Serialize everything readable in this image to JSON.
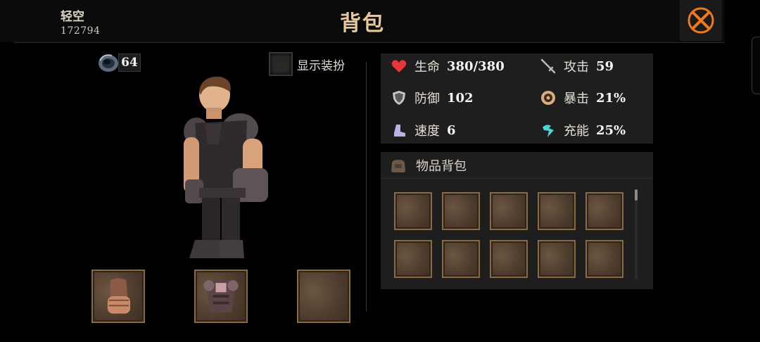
{
  "header": {
    "user_name": "轻空",
    "user_id": "172794",
    "title": "背包"
  },
  "currency": {
    "icon": "ring-currency-icon",
    "value": "64"
  },
  "toggle": {
    "label": "显示装扮",
    "checked": false
  },
  "equipment": {
    "slots": [
      {
        "item": "gauntlet",
        "icon": "gauntlet-icon"
      },
      {
        "item": "chest-armor",
        "icon": "chest-armor-icon"
      },
      {
        "item": null,
        "icon": null
      }
    ]
  },
  "stats": {
    "hp": {
      "label": "生命",
      "value": "380/380",
      "icon": "heart-icon",
      "color": "#e8353a"
    },
    "atk": {
      "label": "攻击",
      "value": "59",
      "icon": "sword-icon",
      "color": "#b9b9b9"
    },
    "def": {
      "label": "防御",
      "value": "102",
      "icon": "shield-icon",
      "color": "#c7c7c7"
    },
    "crit": {
      "label": "暴击",
      "value": "21%",
      "icon": "crit-icon",
      "color": "#d9b07a"
    },
    "spd": {
      "label": "速度",
      "value": "6",
      "icon": "boot-icon",
      "color": "#b9b4e6"
    },
    "charge": {
      "label": "充能",
      "value": "25%",
      "icon": "charge-icon",
      "color": "#4fd2d2"
    }
  },
  "bag": {
    "title": "物品背包",
    "icon": "bag-icon",
    "slot_count": 10
  },
  "colors": {
    "title": "#e7c79b",
    "slot_border": "#8a6a43",
    "close_accent": "#f07a18"
  }
}
